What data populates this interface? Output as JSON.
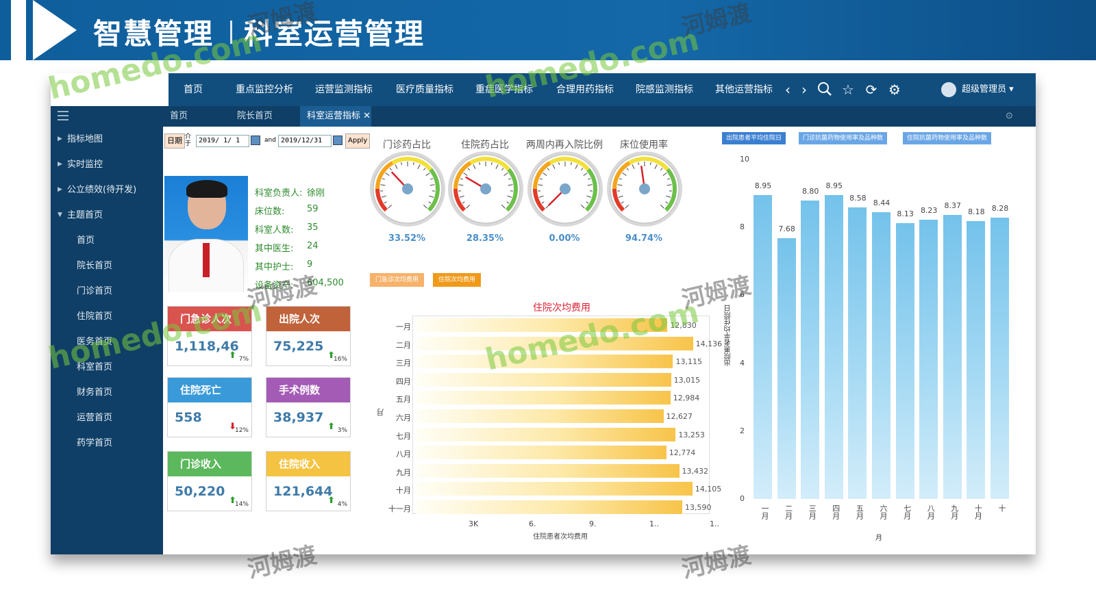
{
  "banner": {
    "title": "智慧管理",
    "subtitle": "科室运营管理"
  },
  "topnav": {
    "items": [
      "首页",
      "重点监控分析",
      "运营监测指标",
      "医疗质量指标",
      "重症医学指标",
      "合理用药指标",
      "院感监测指标",
      "其他运营指标"
    ],
    "user": "超级管理员"
  },
  "subtabs": [
    "首页",
    "院长首页",
    "科室运营指标"
  ],
  "sidebar": {
    "items": [
      "指标地图",
      "实时监控",
      "公立绩效(待开发)",
      "主题首页",
      "首页",
      "院长首页",
      "门诊首页",
      "住院首页",
      "医务首页",
      "科室首页",
      "财务首页",
      "运营首页",
      "药学首页"
    ]
  },
  "filter": {
    "date_label": "日期",
    "between": "介于",
    "start": "2019/ 1/ 1",
    "and": "and",
    "end": "2019/12/31",
    "apply": "Apply"
  },
  "department": {
    "rows": [
      {
        "k": "科室负责人:",
        "v": "徐刚"
      },
      {
        "k": "床位数:",
        "v": "59"
      },
      {
        "k": "科室人数:",
        "v": "35"
      },
      {
        "k": "其中医生:",
        "v": "24"
      },
      {
        "k": "其中护士:",
        "v": "9"
      },
      {
        "k": "设备资产:",
        "v": "604,500"
      }
    ]
  },
  "cards": [
    {
      "title": "门急诊人次",
      "value": "1,118,46",
      "trend": "up",
      "pct": "7%",
      "color": "#d9534f"
    },
    {
      "title": "出院人次",
      "value": "75,225",
      "trend": "up",
      "pct": "16%",
      "color": "#c0623a"
    },
    {
      "title": "住院死亡",
      "value": "558",
      "trend": "down",
      "pct": "12%",
      "color": "#3a9ad9"
    },
    {
      "title": "手术例数",
      "value": "38,937",
      "trend": "up",
      "pct": "3%",
      "color": "#a35bb5"
    },
    {
      "title": "门诊收入",
      "value": "50,220",
      "trend": "up",
      "pct": "14%",
      "color": "#5cb85c"
    },
    {
      "title": "住院收入",
      "value": "121,644",
      "trend": "up",
      "pct": "4%",
      "color": "#f5c342"
    }
  ],
  "gauges": [
    {
      "title": "门诊药占比",
      "value": "33.52%",
      "ratio": 0.34
    },
    {
      "title": "住院药占比",
      "value": "28.35%",
      "ratio": 0.28
    },
    {
      "title": "两周内再入院比例",
      "value": "0.00%",
      "ratio": 0.0
    },
    {
      "title": "床位使用率",
      "value": "94.74%",
      "ratio": 0.47
    }
  ],
  "legend_buttons": [
    "门急诊次均费用",
    "住院次均费用"
  ],
  "right_buttons": [
    "出院患者平均住院日",
    "门诊抗菌药物使用率及品种数",
    "住院抗菌药物使用率及品种数"
  ],
  "chart_data": [
    {
      "type": "bar",
      "orientation": "horizontal",
      "title": "住院次均费用",
      "xlabel": "住院患者次均费用",
      "ylabel": "月",
      "categories": [
        "一月",
        "二月",
        "三月",
        "四月",
        "五月",
        "六月",
        "七月",
        "八月",
        "九月",
        "十月",
        "十一月"
      ],
      "values": [
        12830,
        14136,
        13115,
        13015,
        12984,
        12627,
        13253,
        12774,
        13432,
        14105,
        13590
      ],
      "value_labels": [
        "12,830",
        "14,136",
        "13,115",
        "13,015",
        "12,984",
        "12,627",
        "13,253",
        "12,774",
        "13,432",
        "14,105",
        "13,590"
      ],
      "x_ticks": [
        "3K",
        "6.",
        "9.",
        "1..",
        "1.."
      ],
      "xlim": [
        0,
        14500
      ]
    },
    {
      "type": "bar",
      "title": "",
      "ylabel": "出院患者平均住院日",
      "xlabel": "月",
      "categories": [
        "一月",
        "二月",
        "三月",
        "四月",
        "五月",
        "六月",
        "七月",
        "八月",
        "九月",
        "十月",
        "十"
      ],
      "values": [
        8.95,
        7.68,
        8.8,
        8.95,
        8.58,
        8.44,
        8.13,
        8.23,
        8.37,
        8.18,
        8.28
      ],
      "ylim": [
        0,
        10
      ],
      "y_ticks": [
        "0",
        "2",
        "4",
        "6",
        "8",
        "10"
      ]
    }
  ],
  "watermarks": {
    "brand": "homedo.com",
    "cn": "河姆渡"
  }
}
